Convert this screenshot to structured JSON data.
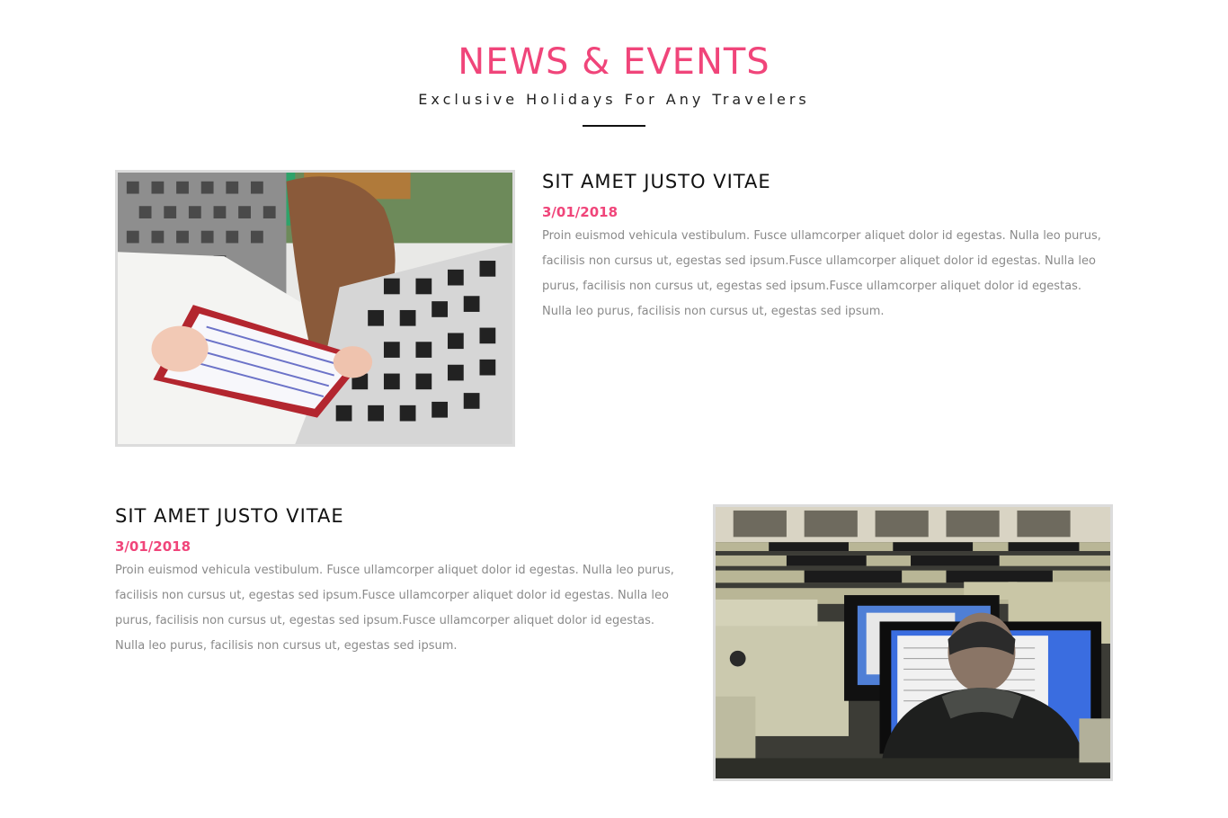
{
  "section": {
    "title": "NEWS & EVENTS",
    "subtitle": "Exclusive Holidays For Any Travelers"
  },
  "posts": [
    {
      "title": "SIT AMET JUSTO VITAE",
      "date": "3/01/2018",
      "text": "Proin euismod vehicula vestibulum. Fusce ullamcorper aliquet dolor id egestas. Nulla leo purus, facilisis non cursus ut, egestas sed ipsum.Fusce ullamcorper aliquet dolor id egestas. Nulla leo purus, facilisis non cursus ut, egestas sed ipsum.Fusce ullamcorper aliquet dolor id egestas. Nulla leo purus, facilisis non cursus ut, egestas sed ipsum.",
      "image": "student-writing-photo"
    },
    {
      "title": "SIT AMET JUSTO VITAE",
      "date": "3/01/2018",
      "text": "Proin euismod vehicula vestibulum. Fusce ullamcorper aliquet dolor id egestas. Nulla leo purus, facilisis non cursus ut, egestas sed ipsum.Fusce ullamcorper aliquet dolor id egestas. Nulla leo purus, facilisis non cursus ut, egestas sed ipsum.Fusce ullamcorper aliquet dolor id egestas. Nulla leo purus, facilisis non cursus ut, egestas sed ipsum.",
      "image": "computer-lab-photo"
    }
  ],
  "colors": {
    "accent": "#f0457a",
    "heading": "#111111",
    "body_text": "#8a8a8a",
    "image_border": "#dcdcdc"
  }
}
